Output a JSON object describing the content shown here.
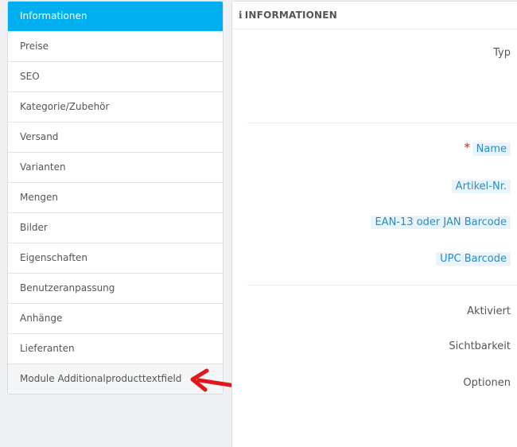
{
  "sidebar": {
    "items": [
      {
        "label": "Informationen"
      },
      {
        "label": "Preise"
      },
      {
        "label": "SEO"
      },
      {
        "label": "Kategorie/Zubehör"
      },
      {
        "label": "Versand"
      },
      {
        "label": "Varianten"
      },
      {
        "label": "Mengen"
      },
      {
        "label": "Bilder"
      },
      {
        "label": "Eigenschaften"
      },
      {
        "label": "Benutzeranpassung"
      },
      {
        "label": "Anhänge"
      },
      {
        "label": "Lieferanten"
      },
      {
        "label": "Module Additionalproducttextfield"
      }
    ]
  },
  "panel": {
    "heading_icon": "i",
    "heading": "INFORMATIONEN",
    "fields": {
      "typ": "Typ",
      "name": "Name",
      "name_required_mark": "*",
      "artikel_nr": "Artikel-Nr.",
      "ean": "EAN-13 oder JAN Barcode",
      "upc": "UPC Barcode",
      "aktiviert": "Aktiviert",
      "sichtbarkeit": "Sichtbarkeit",
      "optionen": "Optionen"
    }
  },
  "annotation": {
    "arrow_color": "#e0161b"
  },
  "colors": {
    "accent": "#00aff0",
    "tooltip_label": "#2d8bbd",
    "required": "#d9534f"
  }
}
